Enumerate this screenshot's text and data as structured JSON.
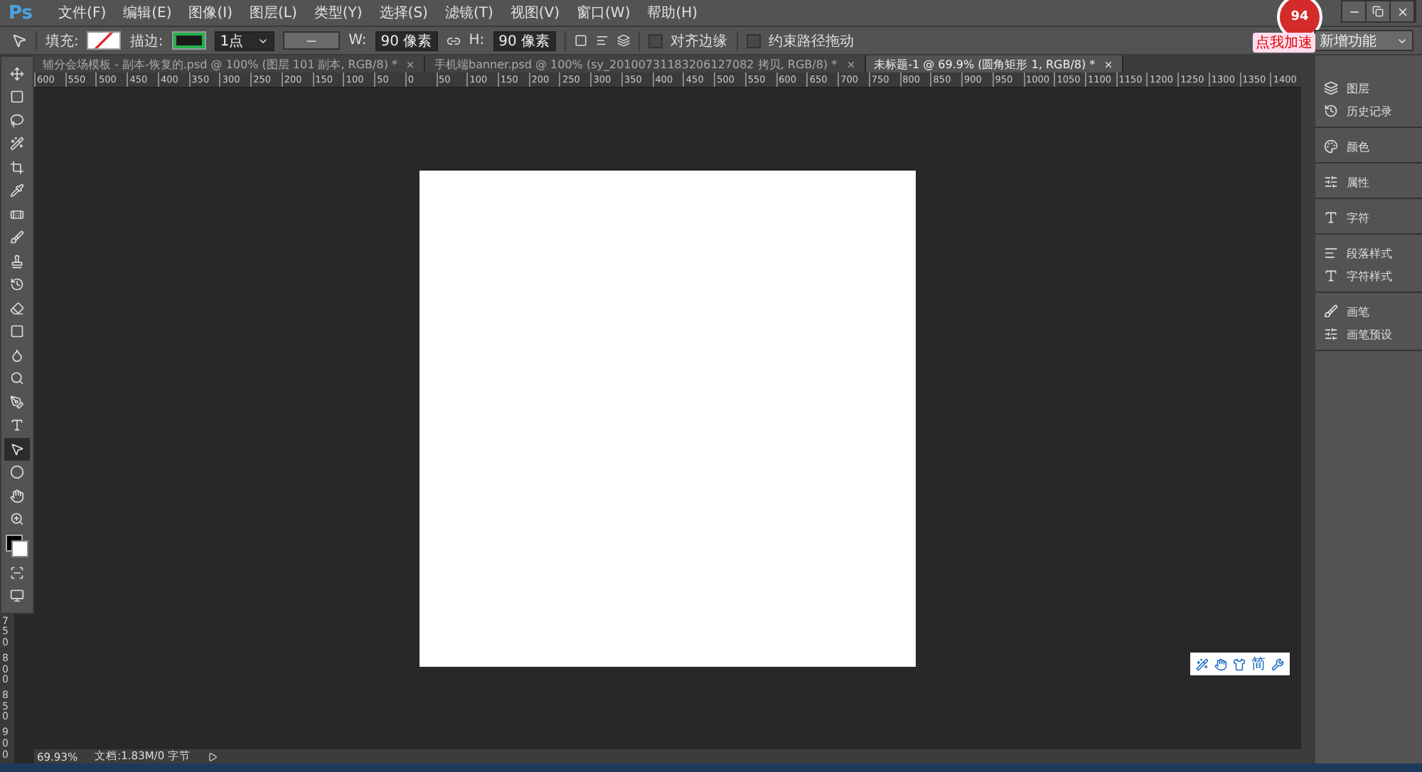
{
  "app": {
    "logo": "Ps"
  },
  "menu": [
    "文件(F)",
    "编辑(E)",
    "图像(I)",
    "图层(L)",
    "类型(Y)",
    "选择(S)",
    "滤镜(T)",
    "视图(V)",
    "窗口(W)",
    "帮助(H)"
  ],
  "accelerator": {
    "score": "94",
    "badge": "点我加速"
  },
  "options": {
    "fill_label": "填充:",
    "stroke_label": "描边:",
    "stroke_width": "1点",
    "w_label": "W:",
    "w_value": "90 像素",
    "h_label": "H:",
    "h_value": "90 像素",
    "checks": [
      {
        "label": "对齐边缘",
        "checked": false
      },
      {
        "label": "约束路径拖动",
        "checked": false
      }
    ],
    "workspace": "新增功能"
  },
  "tabs": [
    {
      "label": "辅分会场模板 - 副本-恢复的.psd @ 100% (图层 101 副本, RGB/8) *",
      "selected": false
    },
    {
      "label": "手机端banner.psd @ 100% (sy_20100731183206127082 拷贝, RGB/8) *",
      "selected": false
    },
    {
      "label": "未标题-1 @ 69.9% (圆角矩形 1, RGB/8) *",
      "selected": true
    }
  ],
  "ruler": [
    "600",
    "550",
    "500",
    "450",
    "400",
    "350",
    "300",
    "250",
    "200",
    "150",
    "100",
    "50",
    "0",
    "50",
    "100",
    "150",
    "200",
    "250",
    "300",
    "350",
    "400",
    "450",
    "500",
    "550",
    "600",
    "650",
    "700",
    "750",
    "800",
    "850",
    "900",
    "950",
    "1000",
    "1050",
    "1100",
    "1150",
    "1200",
    "1250",
    "1300",
    "1350",
    "1400"
  ],
  "vruler": [
    "750",
    "800",
    "850",
    "900"
  ],
  "toolbox": {
    "tools": [
      {
        "selected": false
      },
      {
        "selected": false
      },
      {
        "selected": false
      },
      {
        "selected": false
      },
      {
        "selected": false
      },
      {
        "selected": false
      },
      {
        "selected": false
      },
      {
        "selected": false
      },
      {
        "selected": false
      },
      {
        "selected": false
      },
      {
        "selected": false
      },
      {
        "selected": false
      },
      {
        "selected": false
      },
      {
        "selected": false
      },
      {
        "selected": false
      },
      {
        "selected": false
      },
      {
        "selected": true
      },
      {
        "selected": false
      },
      {
        "selected": false
      },
      {
        "selected": false
      }
    ]
  },
  "panels": [
    [
      "图层",
      "历史记录"
    ],
    [
      "颜色"
    ],
    [
      "属性"
    ],
    [
      "字符"
    ],
    [
      "段落样式",
      "字符样式"
    ],
    [
      "画笔",
      "画笔预设"
    ]
  ],
  "ime": {
    "label": "简"
  },
  "status": {
    "zoom": "69.93%",
    "doc": "文档:1.83M/0 字节"
  }
}
